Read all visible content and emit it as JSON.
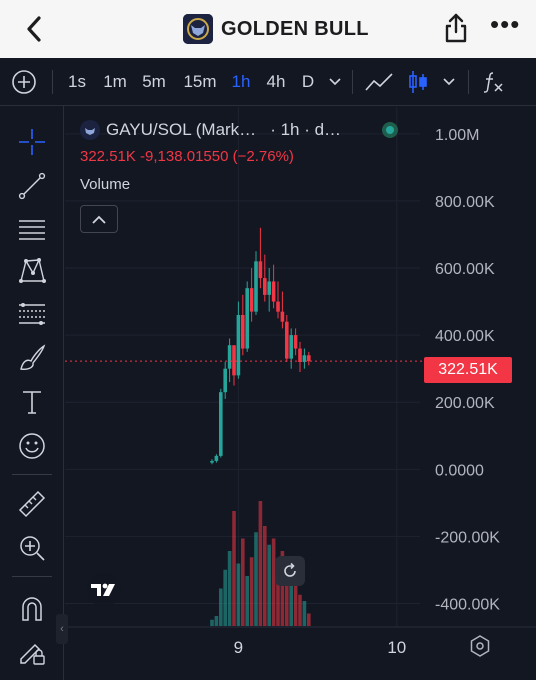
{
  "app": {
    "title": "GOLDEN BULL"
  },
  "toolbar": {
    "timeframes": [
      "1s",
      "1m",
      "5m",
      "15m",
      "1h",
      "4h",
      "D"
    ],
    "active_timeframe": "1h",
    "accent": "#2962ff"
  },
  "legend": {
    "symbol": "GAYU/SOL (Mark…",
    "interval": "· 1h · d…",
    "price_line": "322.51K -9,138.01550 (−2.76%)",
    "indicator": "Volume"
  },
  "price_axis": {
    "labels": [
      "1.00M",
      "800.00K",
      "600.00K",
      "400.00K",
      "200.00K",
      "0.0000",
      "-200.00K",
      "-400.00K"
    ],
    "current_price_label": "322.51K"
  },
  "time_axis": {
    "labels": [
      "9",
      "10"
    ]
  },
  "colors": {
    "up": "#26a69a",
    "down": "#f23645",
    "background": "#131722"
  },
  "chart_data": {
    "type": "candlestick",
    "y_unit": "price",
    "ylim": [
      -470000,
      1080000
    ],
    "last_price": 322510,
    "x_ticks": [
      {
        "index": 6,
        "label": "9"
      },
      {
        "index": 42,
        "label": "10"
      }
    ],
    "candles": [
      [
        20000,
        30000,
        15000,
        25000
      ],
      [
        25000,
        45000,
        20000,
        40000
      ],
      [
        40000,
        240000,
        35000,
        230000
      ],
      [
        230000,
        320000,
        210000,
        300000
      ],
      [
        300000,
        390000,
        260000,
        370000
      ],
      [
        370000,
        360000,
        250000,
        280000
      ],
      [
        280000,
        500000,
        270000,
        460000
      ],
      [
        460000,
        520000,
        340000,
        360000
      ],
      [
        360000,
        560000,
        350000,
        540000
      ],
      [
        540000,
        600000,
        440000,
        470000
      ],
      [
        470000,
        650000,
        460000,
        620000
      ],
      [
        620000,
        720000,
        540000,
        570000
      ],
      [
        570000,
        640000,
        500000,
        520000
      ],
      [
        520000,
        600000,
        470000,
        560000
      ],
      [
        560000,
        610000,
        480000,
        500000
      ],
      [
        500000,
        560000,
        450000,
        470000
      ],
      [
        470000,
        530000,
        420000,
        440000
      ],
      [
        440000,
        460000,
        320000,
        330000
      ],
      [
        330000,
        420000,
        300000,
        400000
      ],
      [
        400000,
        420000,
        340000,
        360000
      ],
      [
        360000,
        380000,
        290000,
        320000
      ],
      [
        320000,
        360000,
        300000,
        340000
      ],
      [
        340000,
        350000,
        310000,
        322510
      ]
    ],
    "volume": [
      5,
      8,
      30,
      45,
      60,
      92,
      50,
      70,
      40,
      55,
      75,
      100,
      80,
      65,
      70,
      50,
      60,
      40,
      45,
      35,
      25,
      20,
      10
    ]
  }
}
